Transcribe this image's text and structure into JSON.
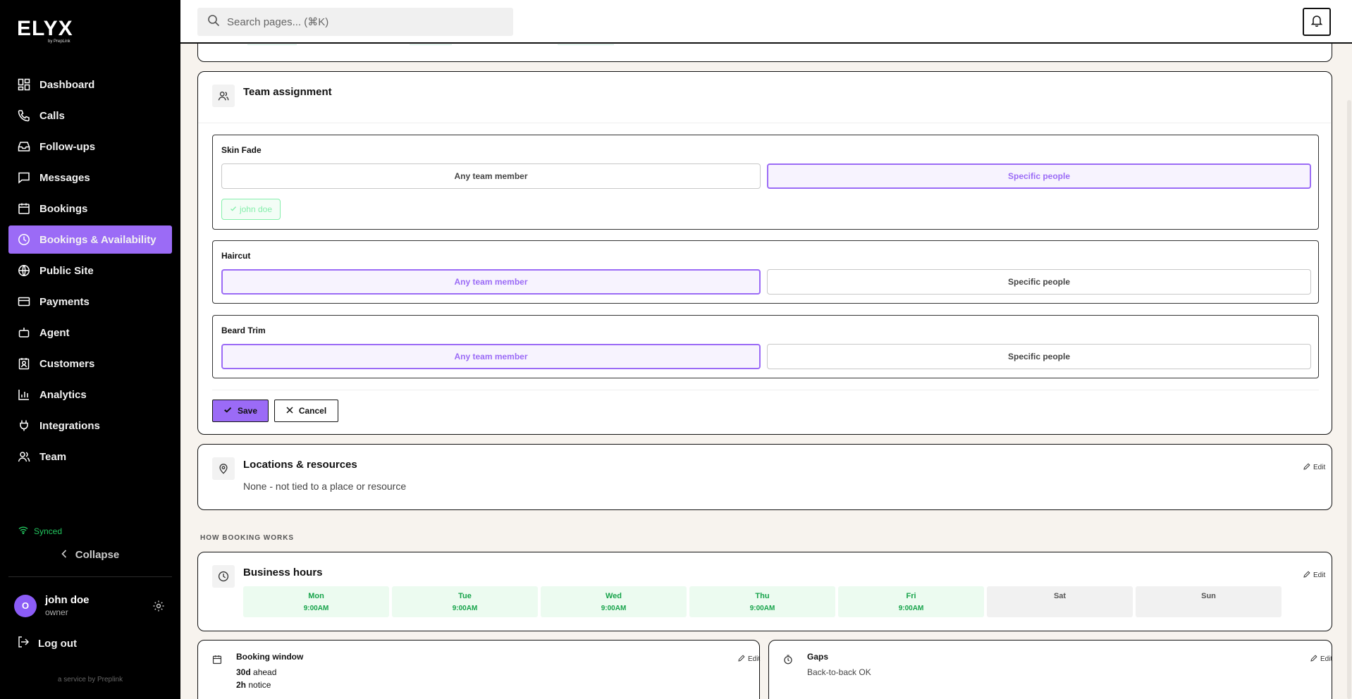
{
  "app": {
    "logo": "ELYX",
    "logo_sub": "by PrepLink"
  },
  "search": {
    "placeholder": "Search pages... (⌘K)"
  },
  "sidebar": {
    "items": [
      {
        "label": "Dashboard",
        "icon": "dashboard-icon"
      },
      {
        "label": "Calls",
        "icon": "phone-icon"
      },
      {
        "label": "Follow-ups",
        "icon": "inbox-icon"
      },
      {
        "label": "Messages",
        "icon": "message-icon"
      },
      {
        "label": "Bookings",
        "icon": "calendar-icon"
      },
      {
        "label": "Bookings & Availability",
        "icon": "clock-icon",
        "active": true
      },
      {
        "label": "Public Site",
        "icon": "globe-icon"
      },
      {
        "label": "Payments",
        "icon": "credit-card-icon"
      },
      {
        "label": "Agent",
        "icon": "bot-icon"
      },
      {
        "label": "Customers",
        "icon": "contact-icon"
      },
      {
        "label": "Analytics",
        "icon": "bar-chart-icon"
      },
      {
        "label": "Integrations",
        "icon": "plug-icon"
      },
      {
        "label": "Team",
        "icon": "users-icon"
      }
    ],
    "synced_label": "Synced",
    "collapse_label": "Collapse",
    "user": {
      "initial": "O",
      "name": "john doe",
      "role": "owner"
    },
    "logout_label": "Log out",
    "service_label": "a service by Preplink"
  },
  "team_assignment": {
    "title": "Team assignment",
    "services": [
      {
        "name": "Skin Fade",
        "options": [
          "Any team member",
          "Specific people"
        ],
        "selected": 1,
        "chips": [
          "john doe"
        ]
      },
      {
        "name": "Haircut",
        "options": [
          "Any team member",
          "Specific people"
        ],
        "selected": 0
      },
      {
        "name": "Beard Trim",
        "options": [
          "Any team member",
          "Specific people"
        ],
        "selected": 0
      }
    ],
    "save_label": "Save",
    "cancel_label": "Cancel"
  },
  "locations": {
    "title": "Locations & resources",
    "value": "None - not tied to a place or resource",
    "edit_label": "Edit"
  },
  "how_booking_works_label": "HOW BOOKING WORKS",
  "business_hours": {
    "title": "Business hours",
    "edit_label": "Edit",
    "days": [
      {
        "name": "Mon",
        "time": "9:00AM",
        "open": true
      },
      {
        "name": "Tue",
        "time": "9:00AM",
        "open": true
      },
      {
        "name": "Wed",
        "time": "9:00AM",
        "open": true
      },
      {
        "name": "Thu",
        "time": "9:00AM",
        "open": true
      },
      {
        "name": "Fri",
        "time": "9:00AM",
        "open": true
      },
      {
        "name": "Sat",
        "time": "",
        "open": false
      },
      {
        "name": "Sun",
        "time": "",
        "open": false
      }
    ]
  },
  "booking_window": {
    "title": "Booking window",
    "edit_label": "Edit",
    "ahead_value": "30d",
    "ahead_label": "ahead",
    "notice_value": "2h",
    "notice_label": "notice"
  },
  "gaps": {
    "title": "Gaps",
    "edit_label": "Edit",
    "value": "Back-to-back OK"
  },
  "colors": {
    "accent": "#9b6bf6",
    "sidebar_bg": "#000000",
    "page_bg": "#f7f3ee",
    "success": "#16a34a"
  }
}
